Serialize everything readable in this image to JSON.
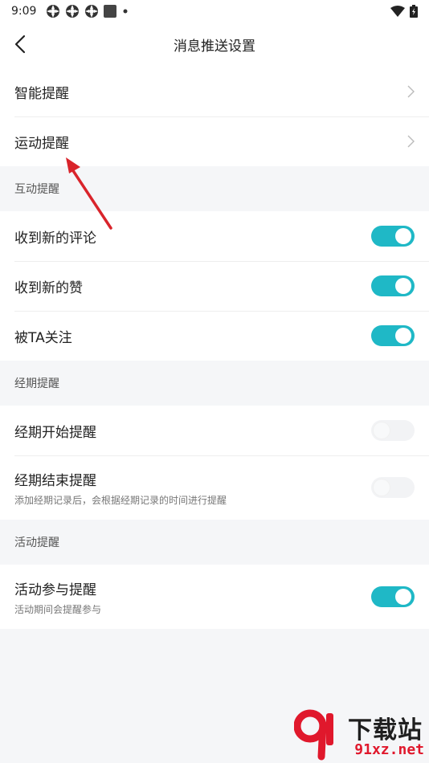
{
  "status_bar": {
    "time": "9:09",
    "icons": [
      "app-icon",
      "app-icon",
      "app-icon",
      "square-icon",
      "dot-icon"
    ],
    "right_icons": [
      "wifi-icon",
      "battery-icon"
    ]
  },
  "nav": {
    "title": "消息推送设置"
  },
  "group_top": [
    {
      "label": "智能提醒"
    },
    {
      "label": "运动提醒"
    }
  ],
  "section_interaction": {
    "title": "互动提醒",
    "items": [
      {
        "label": "收到新的评论",
        "on": true
      },
      {
        "label": "收到新的赞",
        "on": true
      },
      {
        "label": "被TA关注",
        "on": true
      }
    ]
  },
  "section_period": {
    "title": "经期提醒",
    "items": [
      {
        "label": "经期开始提醒",
        "on": false
      },
      {
        "label": "经期结束提醒",
        "sub": "添加经期记录后，会根据经期记录的时间进行提醒",
        "on": false
      }
    ]
  },
  "section_activity": {
    "title": "活动提醒",
    "items": [
      {
        "label": "活动参与提醒",
        "sub": "活动期间会提醒参与",
        "on": true
      }
    ]
  },
  "watermark": {
    "logo_text": "下载站",
    "url": "91xz.net"
  },
  "colors": {
    "accent": "#1fb8c6",
    "annotation_arrow": "#d9242b"
  }
}
